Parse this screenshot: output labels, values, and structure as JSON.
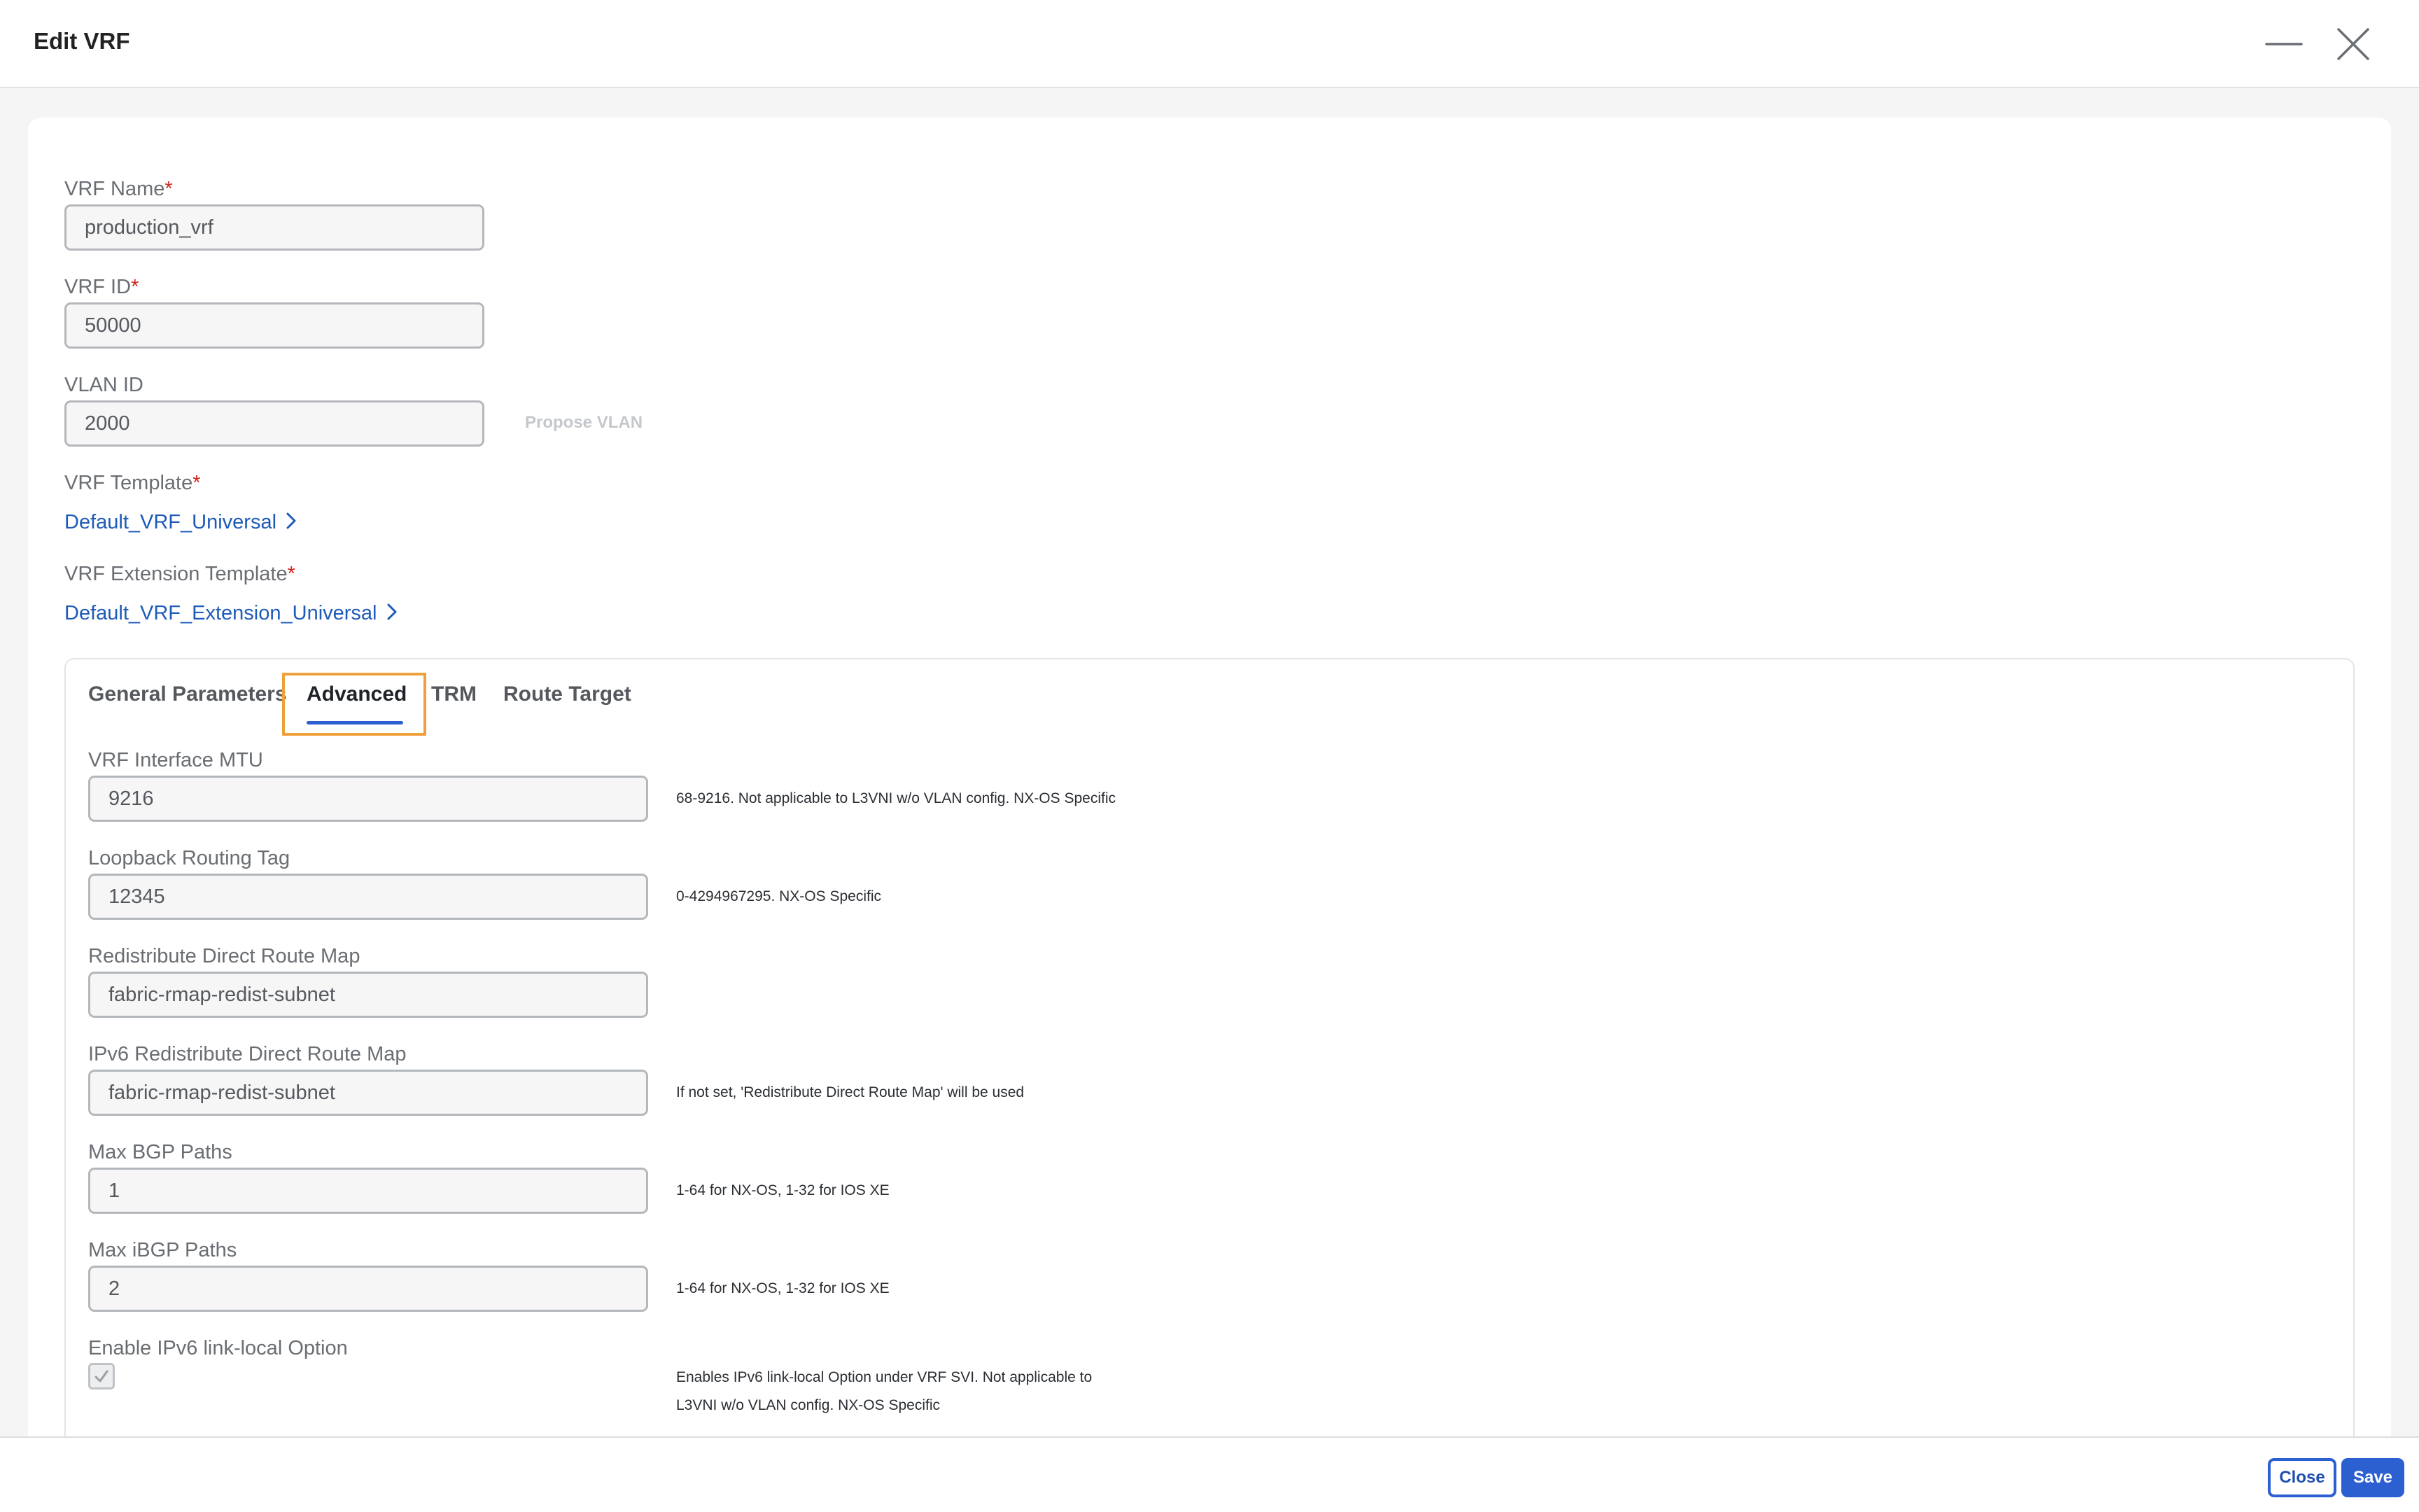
{
  "header": {
    "title": "Edit VRF",
    "minimize_icon": "minimize-icon",
    "close_icon": "close-icon"
  },
  "form": {
    "required_mark": "*",
    "vrf_name": {
      "label": "VRF Name",
      "value": "production_vrf"
    },
    "vrf_id": {
      "label": "VRF ID",
      "value": "50000"
    },
    "vlan_id": {
      "label": "VLAN ID",
      "value": "2000",
      "propose_label": "Propose VLAN"
    },
    "vrf_template": {
      "label": "VRF Template",
      "link": "Default_VRF_Universal"
    },
    "vrf_extension_template": {
      "label": "VRF Extension Template",
      "link": "Default_VRF_Extension_Universal"
    }
  },
  "tabs": [
    {
      "label": "General Parameters"
    },
    {
      "label": "Advanced",
      "active": true
    },
    {
      "label": "TRM"
    },
    {
      "label": "Route Target"
    }
  ],
  "advanced": {
    "mtu": {
      "label": "VRF Interface MTU",
      "value": "9216",
      "hint": "68-9216. Not applicable to L3VNI w/o VLAN config. NX-OS Specific"
    },
    "loopback_tag": {
      "label": "Loopback Routing Tag",
      "value": "12345",
      "hint": "0-4294967295. NX-OS Specific"
    },
    "redist_route_map": {
      "label": "Redistribute Direct Route Map",
      "value": "fabric-rmap-redist-subnet"
    },
    "ipv6_redist_route_map": {
      "label": "IPv6 Redistribute Direct Route Map",
      "value": "fabric-rmap-redist-subnet",
      "hint": "If not set, 'Redistribute Direct Route Map' will be used"
    },
    "max_bgp_paths": {
      "label": "Max BGP Paths",
      "value": "1",
      "hint": "1-64 for NX-OS, 1-32 for IOS XE"
    },
    "max_ibgp_paths": {
      "label": "Max iBGP Paths",
      "value": "2",
      "hint": "1-64 for NX-OS, 1-32 for IOS XE"
    },
    "ipv6_link_local": {
      "label": "Enable IPv6 link-local Option",
      "checked": true,
      "hint_line1": "Enables IPv6 link-local Option under VRF SVI. Not applicable to",
      "hint_line2": "L3VNI w/o VLAN config. NX-OS Specific"
    }
  },
  "footer": {
    "close_label": "Close",
    "save_label": "Save"
  },
  "colors": {
    "accent": "#2c5fd0",
    "link": "#1e5bb8",
    "highlight": "#eea03a",
    "required": "#d0271d"
  }
}
